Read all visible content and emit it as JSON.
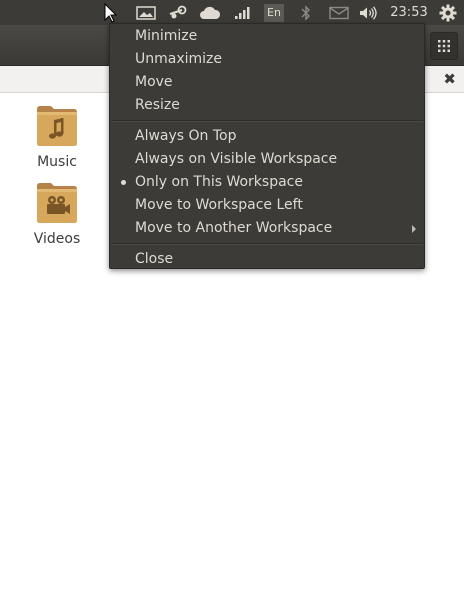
{
  "top_panel": {
    "keyboard_layout": "En",
    "clock": "23:53",
    "icons": [
      "pointer-cursor-icon",
      "photo-app-icon",
      "steam-icon",
      "cloud-icon",
      "network-signal-icon",
      "keyboard-layout-icon",
      "bluetooth-icon",
      "mail-icon",
      "volume-icon",
      "settings-gear-icon"
    ]
  },
  "files": [
    {
      "label": "Music",
      "icon": "music-folder-icon"
    },
    {
      "label": "Videos",
      "icon": "videos-folder-icon"
    }
  ],
  "path_bar": {
    "close_symbol": "✖"
  },
  "window_menu": {
    "items": [
      {
        "label": "Minimize"
      },
      {
        "label": "Unmaximize"
      },
      {
        "label": "Move"
      },
      {
        "label": "Resize"
      },
      {
        "label": "Always On Top"
      },
      {
        "label": "Always on Visible Workspace"
      },
      {
        "label": "Only on This Workspace",
        "selected": true
      },
      {
        "label": "Move to Workspace Left"
      },
      {
        "label": "Move to Another Workspace",
        "has_submenu": true
      },
      {
        "label": "Close"
      }
    ]
  },
  "colors": {
    "panel": "#3c3b37",
    "menu_text": "#dfdbd2",
    "folder": "#d7a75c"
  }
}
